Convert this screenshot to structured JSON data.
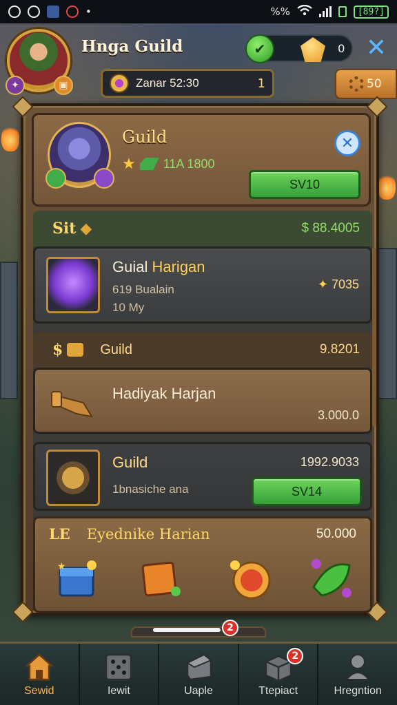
{
  "status_bar": {
    "signal_text": "%%",
    "battery": "[89?]"
  },
  "header": {
    "title": "Hnga Guild",
    "gem_value": "0",
    "resource_label": "Zanar 52:30",
    "resource_count": "1",
    "side_resource": "50"
  },
  "guild_card": {
    "title": "Guild",
    "stats": "11A 1800",
    "button_label": "SV10"
  },
  "sections": [
    {
      "header_left": "Sit",
      "header_right": "$ 88.4005",
      "item": {
        "title_a": "Guial",
        "title_b": "Harigan",
        "sub1": "619 Bualain",
        "sub2": "10 My",
        "right": "7035"
      }
    },
    {
      "header_left": "Guild",
      "header_right": "9.8201",
      "item": {
        "title": "Hadiyak Harjan",
        "right": "3.000.0"
      }
    },
    {
      "item": {
        "title": "Guild",
        "sub": "1bnasiche ana",
        "right": "1992.9033",
        "button_label": "SV14"
      }
    }
  ],
  "reward_strip": {
    "label_left": "LE",
    "label_main": "Eyednike Harian",
    "right": "50.000"
  },
  "badges": {
    "home_notif": "2",
    "tab_notif": "2"
  },
  "bottom_nav": [
    {
      "label": "Sewid",
      "icon": "house-icon",
      "active": true
    },
    {
      "label": "Iewit",
      "icon": "dice-icon",
      "active": false
    },
    {
      "label": "Uaple",
      "icon": "chest-icon",
      "active": false
    },
    {
      "label": "Ttepiact",
      "icon": "crate-icon",
      "active": false
    },
    {
      "label": "Hregntion",
      "icon": "profile-icon",
      "active": false
    }
  ],
  "colors": {
    "accent_gold": "#ffd76a",
    "accent_green": "#8fe06a",
    "button_green": "#36a03a",
    "panel_brown": "#6b5338",
    "nav_active": "#ffb24a"
  }
}
